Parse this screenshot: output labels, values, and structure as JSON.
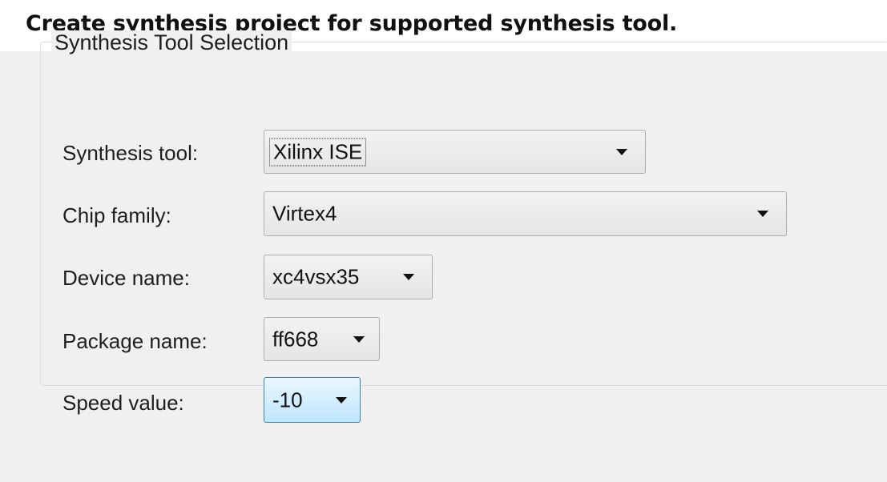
{
  "page": {
    "heading": "Create synthesis project for supported synthesis tool."
  },
  "group": {
    "title": "Synthesis Tool Selection",
    "rows": [
      {
        "label": "Synthesis tool:",
        "value": "Xilinx ISE"
      },
      {
        "label": "Chip family:",
        "value": "Virtex4"
      },
      {
        "label": "Device name:",
        "value": "xc4vsx35"
      },
      {
        "label": "Package name:",
        "value": "ff668"
      },
      {
        "label": "Speed value:",
        "value": "-10"
      }
    ]
  },
  "icons": {
    "dropdown": "chevron-down-icon"
  },
  "colors": {
    "dialog_background": "#f0f0f0",
    "header_background": "#ffffff",
    "hot_combo_border": "#3c7fb1",
    "hot_combo_fill": "#bee6fd"
  }
}
